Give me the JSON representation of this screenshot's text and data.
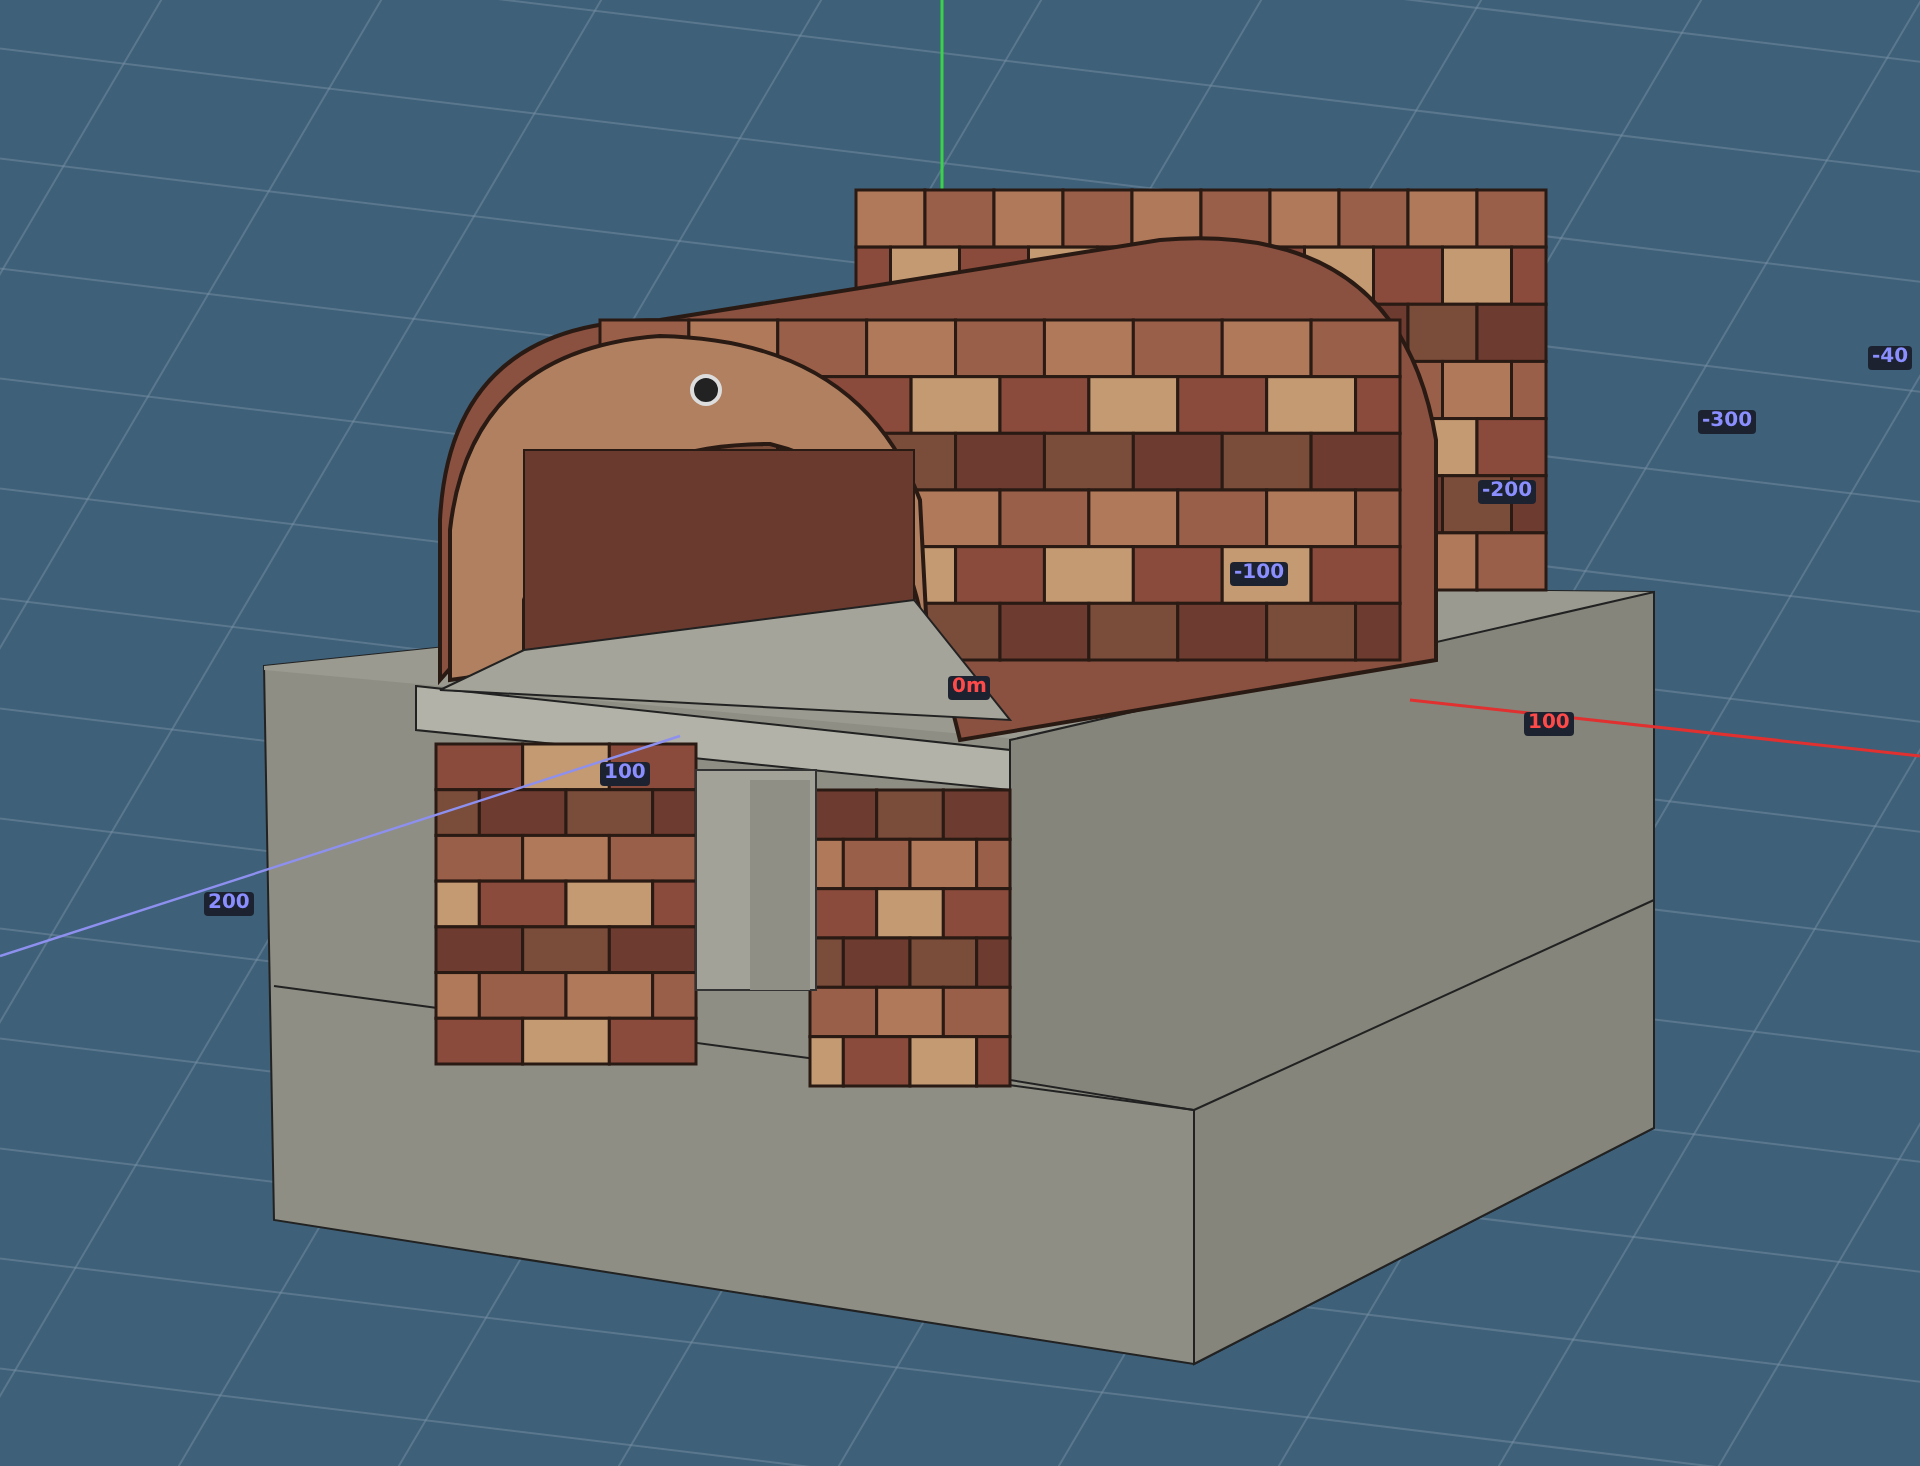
{
  "viewport": {
    "axis_labels": [
      {
        "text": "-40",
        "kind": "z"
      },
      {
        "text": "-300",
        "kind": "z"
      },
      {
        "text": "-200",
        "kind": "z"
      },
      {
        "text": "-100",
        "kind": "z"
      },
      {
        "text": "0m",
        "kind": "x"
      },
      {
        "text": "100",
        "kind": "x"
      },
      {
        "text": "100",
        "kind": "z"
      },
      {
        "text": "200",
        "kind": "z"
      }
    ]
  }
}
